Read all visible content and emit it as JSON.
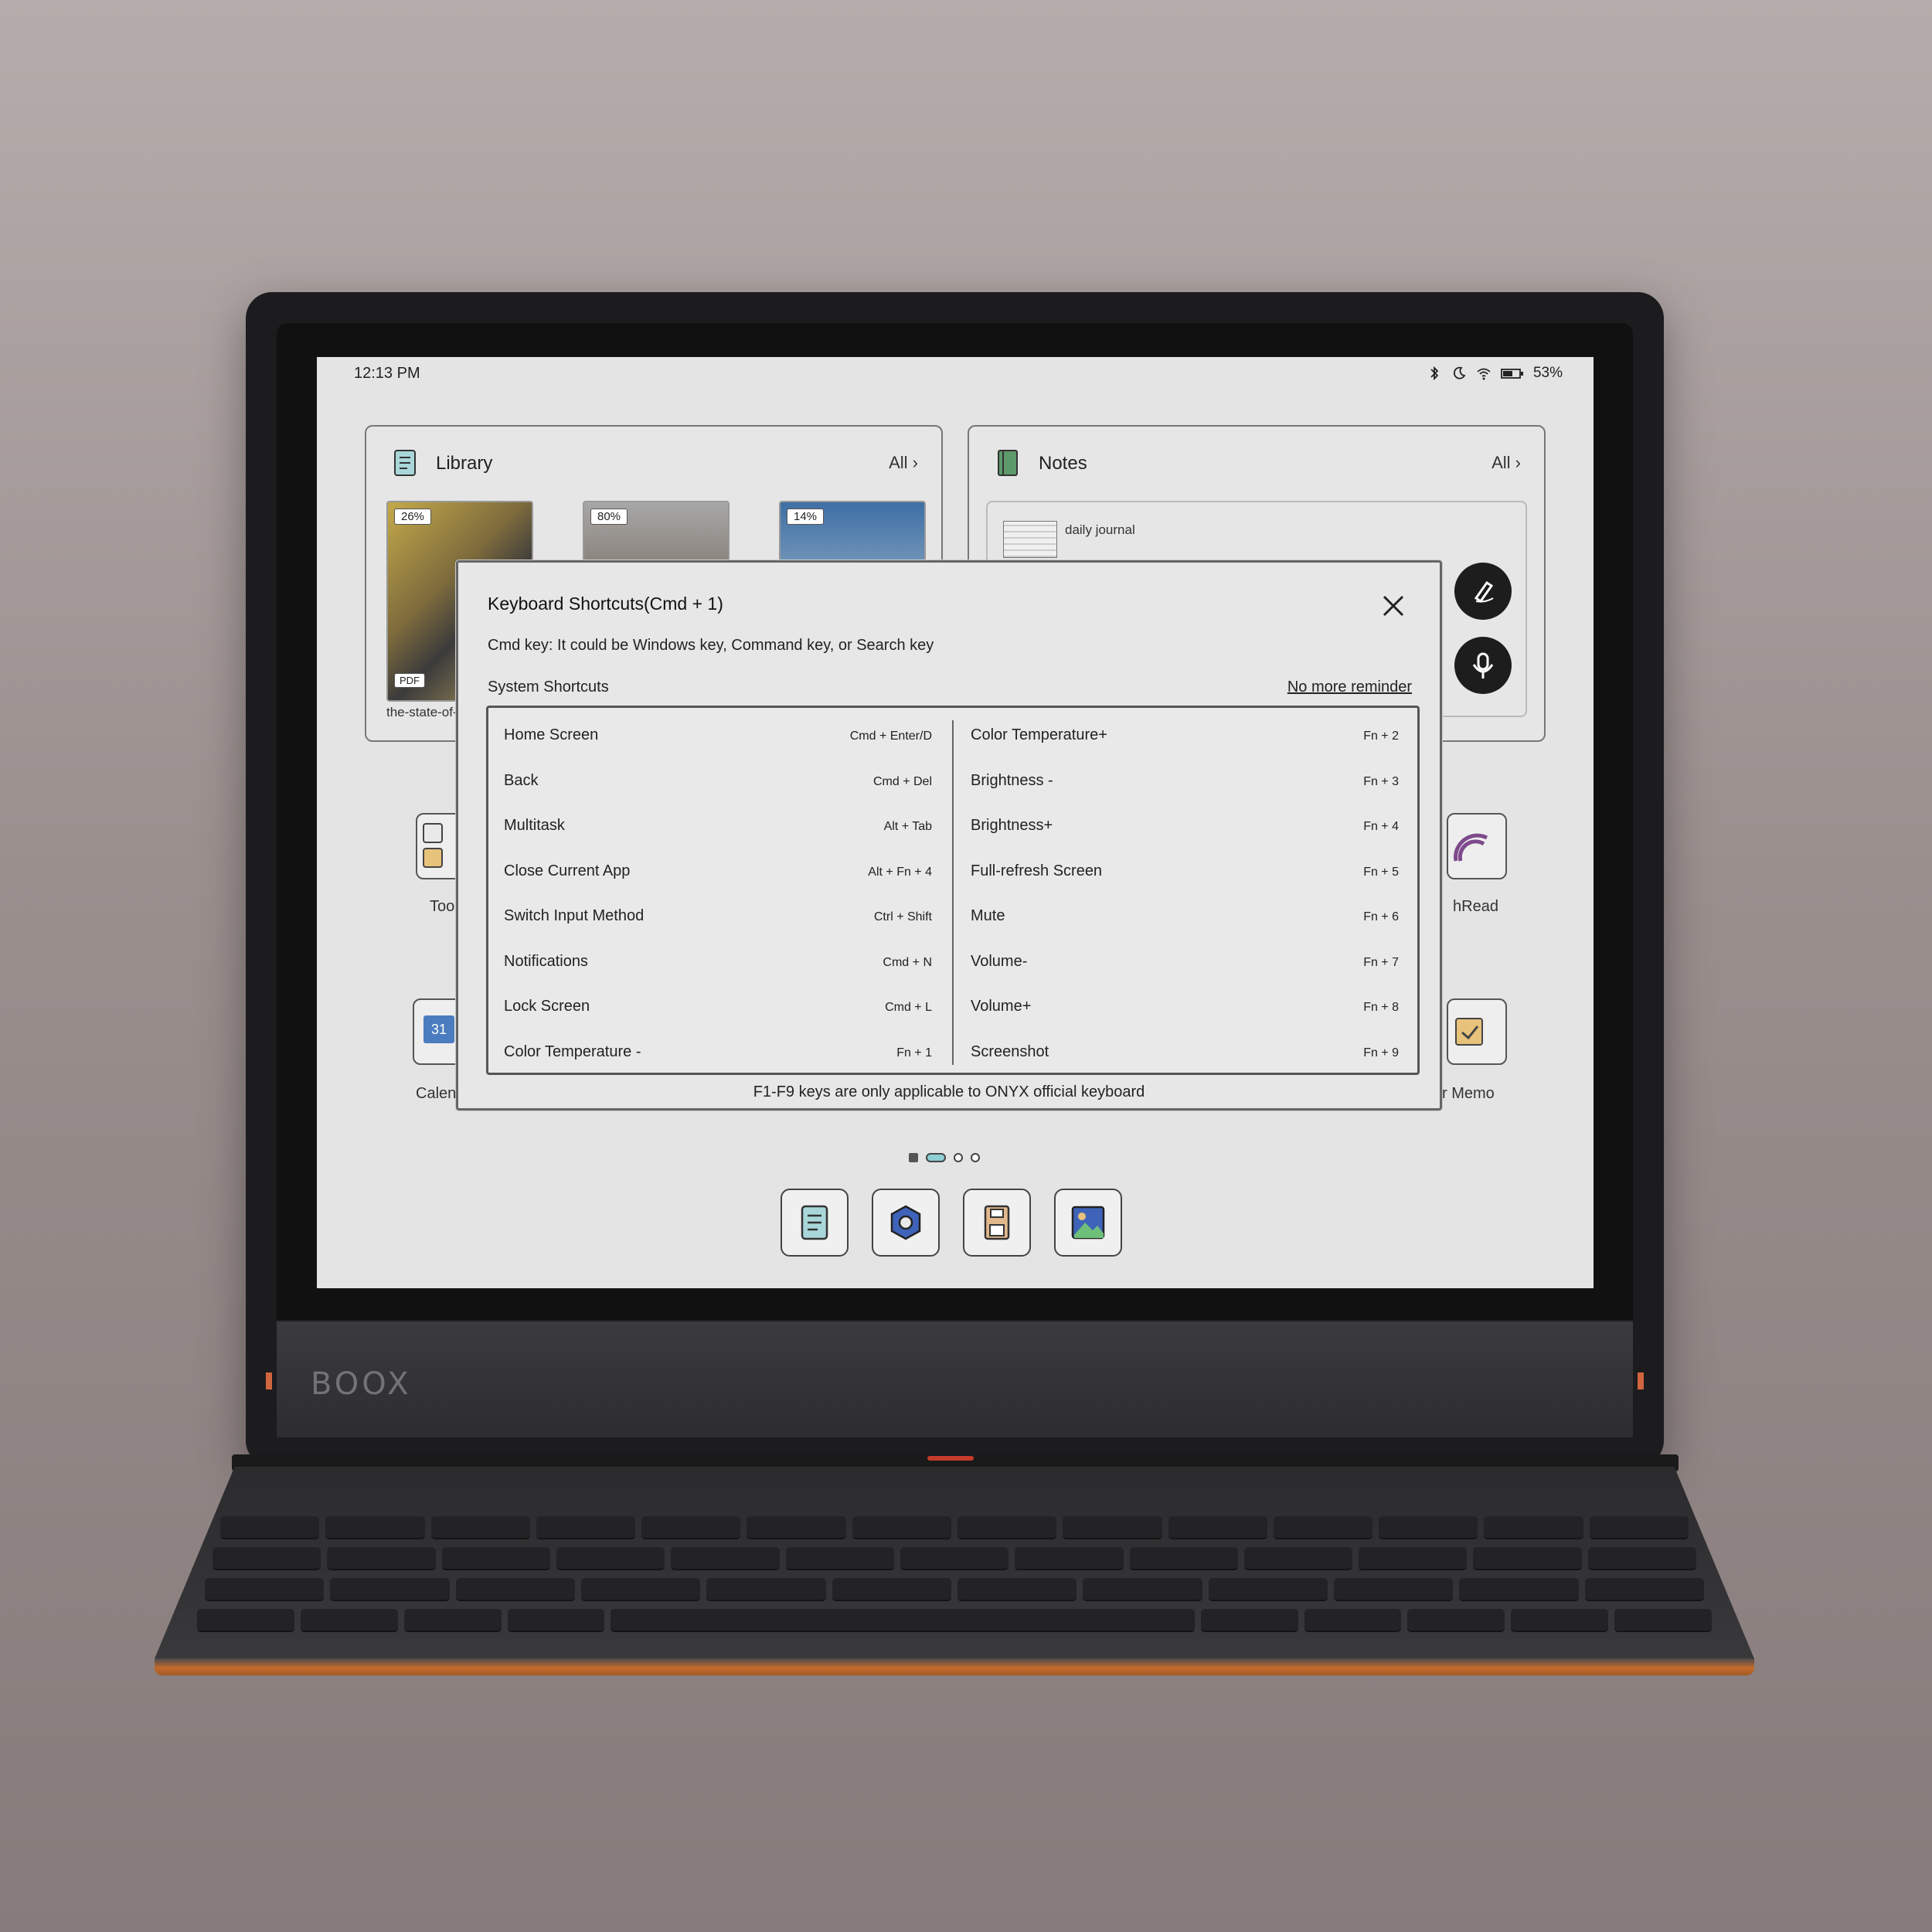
{
  "device": {
    "brand": "BOOX"
  },
  "status_bar": {
    "time": "12:13 PM",
    "battery": "53%"
  },
  "library": {
    "title": "Library",
    "all_label": "All",
    "books": [
      {
        "progress": "26%",
        "type_badge": "PDF",
        "caption": "the-state-of-t"
      },
      {
        "progress": "80%"
      },
      {
        "progress": "14%"
      }
    ]
  },
  "notes": {
    "title": "Notes",
    "all_label": "All",
    "item_label": "daily journal"
  },
  "apps": {
    "tools_label": "Too",
    "neoread_label": "hRead",
    "calendar_label": "Calen",
    "memo_label": "r Memo",
    "calendar_day": "31"
  },
  "dialog": {
    "title": "Keyboard Shortcuts(Cmd + 1)",
    "cmd_note": "Cmd key:  It could be Windows key, Command key, or Search key",
    "section": "System Shortcuts",
    "no_more_reminder": "No more reminder",
    "left_shortcuts": [
      {
        "name": "Home Screen",
        "keys": "Cmd + Enter/D"
      },
      {
        "name": "Back",
        "keys": "Cmd + Del"
      },
      {
        "name": "Multitask",
        "keys": "Alt + Tab"
      },
      {
        "name": "Close Current App",
        "keys": "Alt + Fn + 4"
      },
      {
        "name": "Switch Input Method",
        "keys": "Ctrl + Shift"
      },
      {
        "name": "Notifications",
        "keys": "Cmd + N"
      },
      {
        "name": "Lock Screen",
        "keys": "Cmd + L"
      },
      {
        "name": "Color Temperature -",
        "keys": "Fn + 1"
      }
    ],
    "right_shortcuts": [
      {
        "name": "Color Temperature+",
        "keys": "Fn + 2"
      },
      {
        "name": "Brightness -",
        "keys": "Fn + 3"
      },
      {
        "name": "Brightness+",
        "keys": "Fn + 4"
      },
      {
        "name": "Full-refresh Screen",
        "keys": "Fn + 5"
      },
      {
        "name": "Mute",
        "keys": "Fn + 6"
      },
      {
        "name": "Volume-",
        "keys": "Fn + 7"
      },
      {
        "name": "Volume+",
        "keys": "Fn + 8"
      },
      {
        "name": "Screenshot",
        "keys": "Fn + 9"
      }
    ],
    "footer": "F1-F9 keys are only applicable to ONYX official keyboard"
  },
  "dock": {
    "items": [
      "library-icon",
      "settings-icon",
      "storage-icon",
      "gallery-icon"
    ]
  },
  "colors": {
    "accent_teal": "#8ecfd3",
    "keyboard_trim": "#c26b2c"
  }
}
